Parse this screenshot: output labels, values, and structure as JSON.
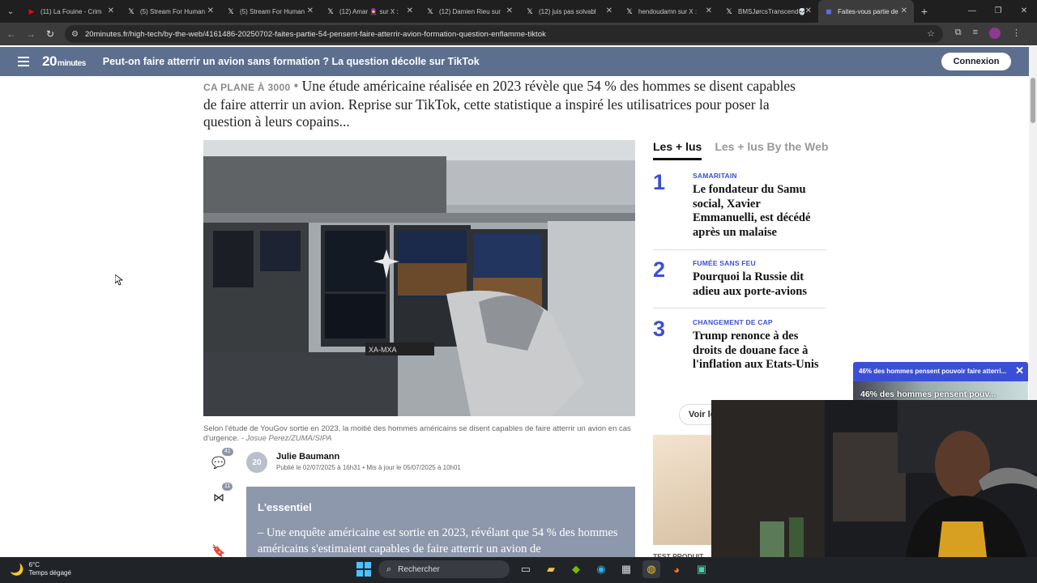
{
  "browser": {
    "tabs": [
      {
        "label": "(11) La Fouine - Crim",
        "icon": "youtube-icon",
        "color": "#ff0000"
      },
      {
        "label": "(5) Stream For Human",
        "icon": "x-icon",
        "color": "#ffffff"
      },
      {
        "label": "(5) Stream For Human",
        "icon": "x-icon",
        "color": "#ffffff"
      },
      {
        "label": "(12) Amar 🧕 sur X :",
        "icon": "x-icon",
        "color": "#ffffff"
      },
      {
        "label": "(12) Damien Rieu sur",
        "icon": "x-icon",
        "color": "#ffffff"
      },
      {
        "label": "(12) juis pas solvabl",
        "icon": "x-icon",
        "color": "#ffffff"
      },
      {
        "label": "hendoudamn sur X :",
        "icon": "x-icon",
        "color": "#ffffff"
      },
      {
        "label": "BMSJørcsTranscend💀",
        "icon": "x-icon",
        "color": "#ffffff"
      },
      {
        "label": "Faites-vous partie de",
        "icon": "20minutes-icon",
        "color": "#5c6fd6",
        "active": true
      }
    ],
    "url": "20minutes.fr/high-tech/by-the-web/4161486-20250702-faites-partie-54-pensent-faire-atterrir-avion-formation-question-enflamme-tiktok"
  },
  "site": {
    "logo_main": "20",
    "logo_small": "minutes",
    "header_title": "Peut-on faire atterrir un avion sans formation ? La question décolle sur TikTok",
    "login_label": "Connexion",
    "header_color": "#5c6f8e",
    "accent_color": "#3b4fd6"
  },
  "article": {
    "kicker": "CA PLANE À 3000",
    "lead": "Une étude américaine réalisée en 2023 révèle que 54 % des hommes se disent capables de faire atterrir un avion. Reprise sur TikTok, cette statistique a inspiré les utilisatrices pour poser la question à leurs copains...",
    "caption": "Selon l'étude de YouGov sortie en 2023, la moitié des hommes américains se disent capables de faire atterrir un avion en cas d'urgence.",
    "credit": "- Josue Perez/ZUMA/SIPA",
    "comments_count": "41",
    "shares_count": "11",
    "author_initials": "20",
    "author": "Julie Baumann",
    "published": "Publié le 02/07/2025 à 16h31 • Mis à jour le 05/07/2025 à 10h01",
    "essentiel_title": "L'essentiel",
    "essentiel_text": "Une enquête américaine est sortie en 2023, révélant que 54 % des hommes américains s'estimaient capables de faire atterrir un avion de"
  },
  "sidebar": {
    "tab_active": "Les + lus",
    "tab_other": "Les + lus By the Web",
    "items": [
      {
        "num": "1",
        "tag": "SAMARITAIN",
        "title": "Le fondateur du Samu social, Xavier Emmanuelli, est décédé après un malaise"
      },
      {
        "num": "2",
        "tag": "FUMÉE SANS FEU",
        "title": "Pourquoi la Russie dit adieu aux porte-avions"
      },
      {
        "num": "3",
        "tag": "CHANGEMENT DE CAP",
        "title": "Trump renonce à des droits de douane face à l'inflation aux Etats-Unis"
      }
    ],
    "voir_label": "Voir le",
    "promo_tag": "TEST PRODUIT"
  },
  "video": {
    "title": "46% des hommes pensent pouvoir faire atterri...",
    "subtitle": "46% des hommes pensent pouv..."
  },
  "taskbar": {
    "temp": "6°C",
    "weather": "Temps dégagé",
    "search_placeholder": "Rechercher"
  }
}
